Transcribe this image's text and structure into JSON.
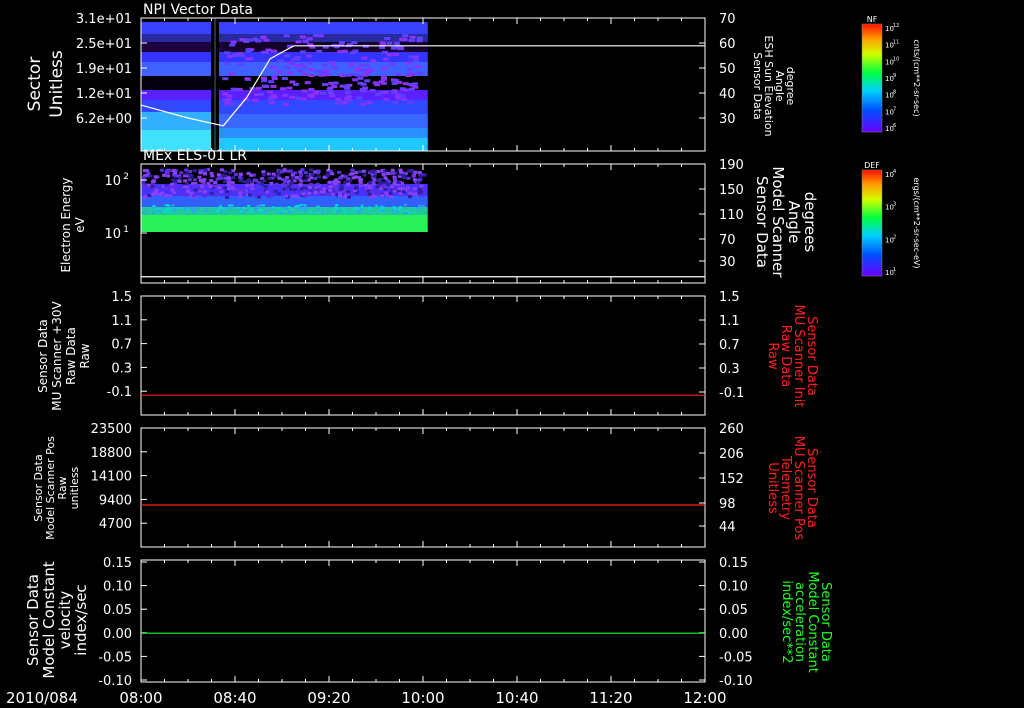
{
  "colors": {
    "background": "#000000",
    "axis": "#ffffff",
    "red": "#ff2020",
    "green": "#20ff20",
    "white": "#ffffff"
  },
  "time_axis": {
    "date_label": "2010/084",
    "ticks": [
      "08:00",
      "08:40",
      "09:20",
      "10:00",
      "10:40",
      "11:20",
      "12:00"
    ],
    "range_hours": [
      8.0,
      12.0
    ]
  },
  "chart_data": [
    {
      "type": "heatmap",
      "title": "NPI Vector Data",
      "ylabel_left": [
        "Sector",
        "Unitless"
      ],
      "yticks_left": [
        "3.1e+01",
        "2.5e+01",
        "1.9e+01",
        "1.2e+01",
        "6.2e+00"
      ],
      "ylabel_right": [
        "Sensor Data",
        "ESH Sun Elevation",
        "Angle",
        "degree"
      ],
      "yticks_right": [
        "70",
        "60",
        "50",
        "40",
        "30"
      ],
      "ylim_right": [
        20,
        70
      ],
      "data_end_time": "10:02",
      "line_series": {
        "name": "ESH Sun Elevation Angle",
        "x": [
          "08:00",
          "08:20",
          "08:35",
          "08:45",
          "08:55",
          "09:05",
          "12:00"
        ],
        "y": [
          37,
          32,
          29,
          40,
          55,
          60,
          60
        ]
      },
      "colorbar": {
        "label": "NF",
        "units": "cnts/(cm**2-sr-sec)",
        "ticks": [
          "10^12",
          "10^11",
          "10^10",
          "10^9",
          "10^8",
          "10^7",
          "10^6"
        ]
      }
    },
    {
      "type": "heatmap",
      "title": "MEx ELS-01 LR",
      "ylabel_left": [
        "Electron Energy",
        "eV"
      ],
      "yticks_left": [
        "10^2",
        "10^1"
      ],
      "ylabel_right": [
        "Sensor Data",
        "Model Scanner",
        "Angle",
        "degrees"
      ],
      "yticks_right": [
        "190",
        "150",
        "110",
        "70",
        "30"
      ],
      "ylim_right": [
        0,
        190
      ],
      "data_end_time": "10:02",
      "line_series": {
        "name": "Model Scanner Angle",
        "x": [
          "08:00",
          "12:00"
        ],
        "y": [
          10,
          10
        ]
      },
      "colorbar": {
        "label": "DEF",
        "units": "ergs/(cm**2-sr-sec-eV)",
        "ticks": [
          "10^4",
          "10^3",
          "10^2",
          "10^1"
        ]
      }
    },
    {
      "type": "line",
      "ylabel_left": [
        "Sensor Data",
        "MU Scanner +30V",
        "Raw Data",
        "Raw"
      ],
      "yticks_left": [
        "1.5",
        "1.1",
        "0.7",
        "0.3",
        "-0.1"
      ],
      "ylim_left": [
        -0.3,
        1.5
      ],
      "ylabel_right": [
        "Sensor Data",
        "MU Scanner Init",
        "Raw Data",
        "Raw"
      ],
      "yticks_right": [
        "1.5",
        "1.1",
        "0.7",
        "0.3",
        "-0.1"
      ],
      "series": [
        {
          "x": [
            "08:00",
            "12:00"
          ],
          "values": [
            0.0,
            0.0
          ]
        }
      ]
    },
    {
      "type": "line",
      "ylabel_left": [
        "Sensor Data",
        "Model Scanner Pos",
        "Raw",
        "unitless"
      ],
      "yticks_left": [
        "23500",
        "18800",
        "14100",
        "9400",
        "4700"
      ],
      "ylim_left": [
        0,
        23500
      ],
      "ylabel_right": [
        "Sensor Data",
        "MU Scanner Pos",
        "Telemetry",
        "Unitless"
      ],
      "yticks_right": [
        "260",
        "206",
        "152",
        "98",
        "44"
      ],
      "series": [
        {
          "x": [
            "08:00",
            "12:00"
          ],
          "values": [
            8300,
            8300
          ]
        }
      ]
    },
    {
      "type": "line",
      "ylabel_left": [
        "Sensor Data",
        "Model Constant",
        "velocity",
        "index/sec"
      ],
      "yticks_left": [
        "0.15",
        "0.10",
        "0.05",
        "0.00",
        "-0.05",
        "-0.10"
      ],
      "ylim_left": [
        -0.1,
        0.15
      ],
      "ylabel_right": [
        "Sensor Data",
        "Model Constant",
        "acceleration",
        "index/sec**2"
      ],
      "yticks_right": [
        "0.15",
        "0.10",
        "0.05",
        "0.00",
        "-0.05",
        "-0.10"
      ],
      "series": [
        {
          "x": [
            "08:00",
            "12:00"
          ],
          "values": [
            0.0,
            0.0
          ]
        }
      ]
    }
  ]
}
